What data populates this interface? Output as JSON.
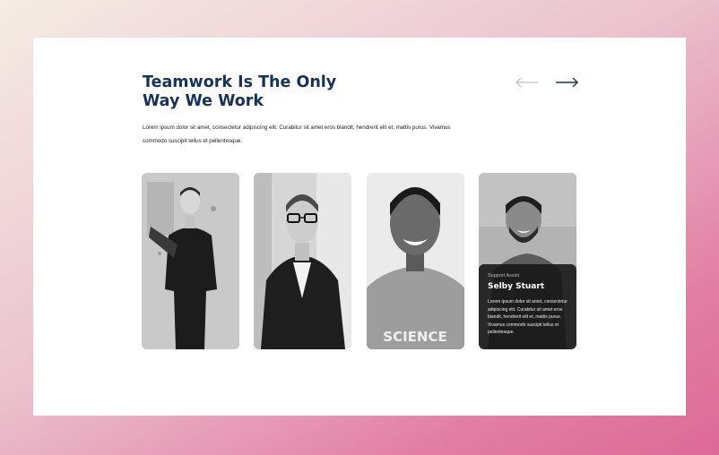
{
  "section": {
    "title_line1": "Teamwork Is The Only",
    "title_line2": "Way We Work",
    "description": "Lorem ipsum dolor sit amet, consectetur adipiscing elit. Curabitur sit amet eros blandit, hendrerit elit et, mattis purus. Vivamus commodo suscipit tellus et pellentesque."
  },
  "navigation": {
    "prev_icon": "arrow-left-icon",
    "next_icon": "arrow-right-icon"
  },
  "team": [
    {
      "photo": "portrait-man-gym-bag"
    },
    {
      "photo": "portrait-man-glasses-suit"
    },
    {
      "photo": "portrait-man-smiling-science-shirt",
      "shirt_text": "SCIENCE"
    },
    {
      "photo": "portrait-man-smiling-beard",
      "role": "Support Assist",
      "name": "Selby Stuart",
      "bio": "Lorem ipsum dolor sit amet, consectetur adipiscing elit. Curabitur sit amet eros blandit, hendrerit elit et, mattis purus. Vivamus commodo suscipit tellus et pellentesque."
    }
  ],
  "colors": {
    "heading": "#16325c",
    "arrow_inactive": "#b9bdc7",
    "arrow_active": "#16325c",
    "overlay": "#141414"
  }
}
